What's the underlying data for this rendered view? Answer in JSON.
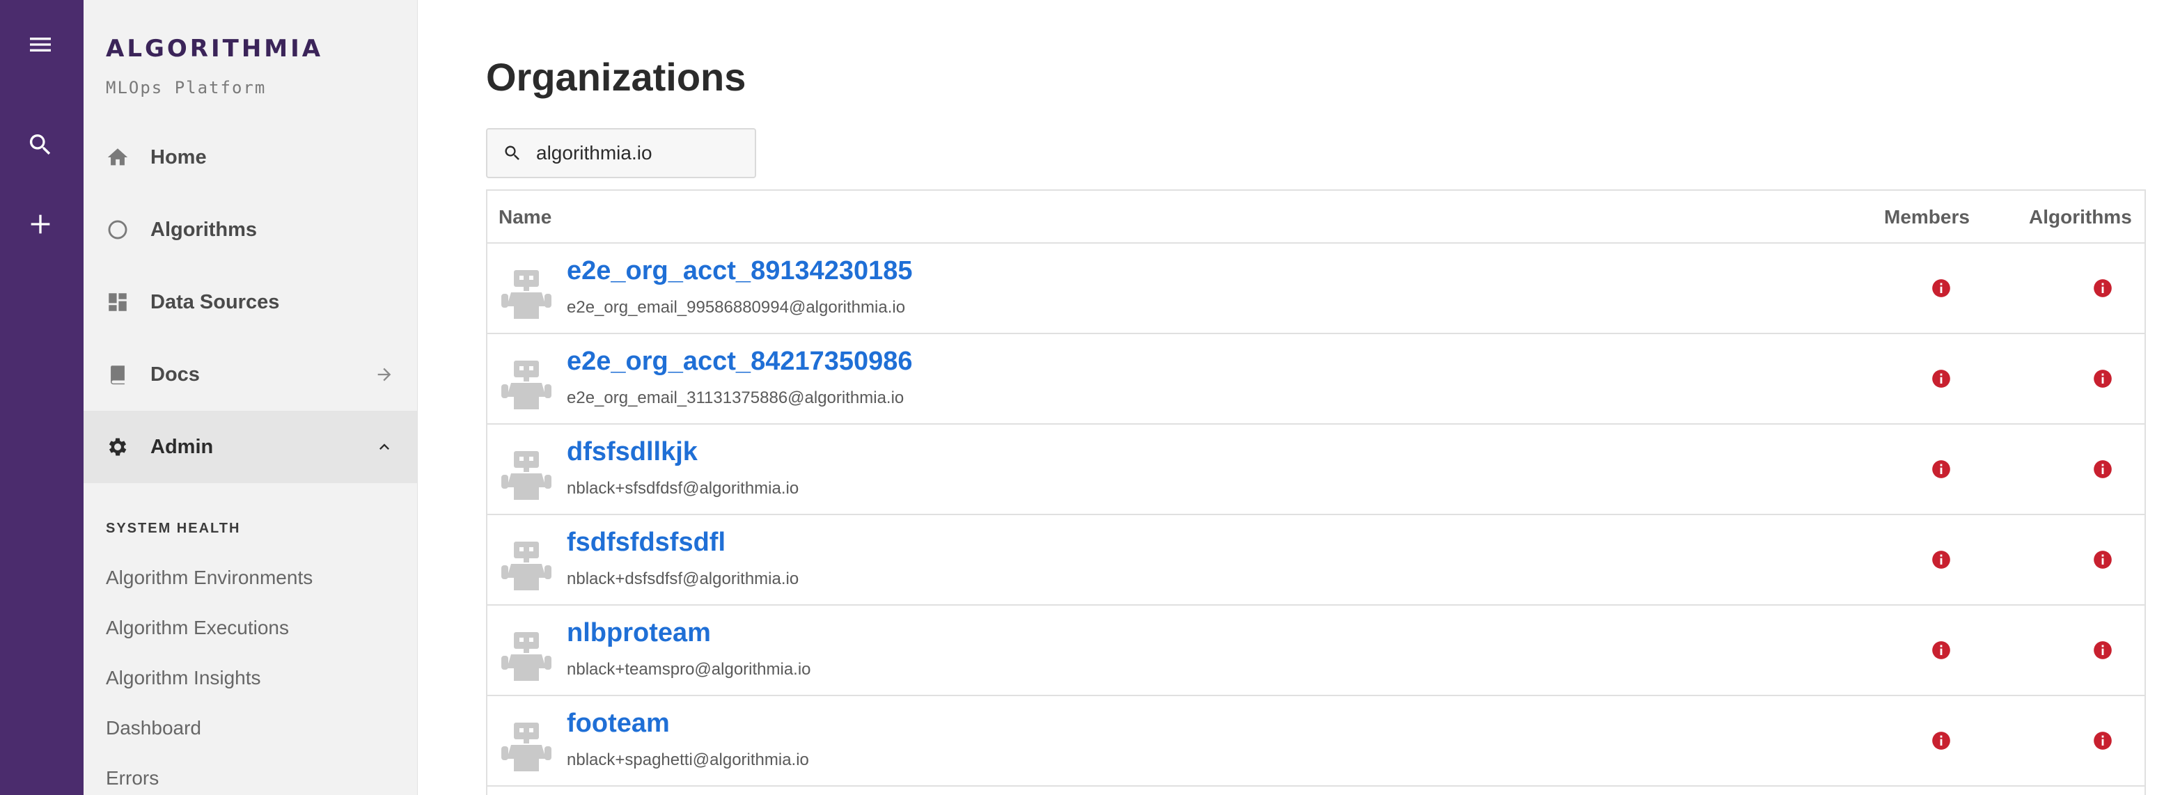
{
  "brand": {
    "name": "ALGORITHMIA",
    "tagline": "MLOps Platform"
  },
  "rail": {
    "icons": [
      "menu-icon",
      "search-icon",
      "plus-icon"
    ]
  },
  "nav": {
    "home": "Home",
    "algorithms": "Algorithms",
    "data_sources": "Data Sources",
    "docs": "Docs",
    "admin": "Admin"
  },
  "system_health": {
    "title": "SYSTEM HEALTH",
    "items": [
      "Algorithm Environments",
      "Algorithm Executions",
      "Algorithm Insights",
      "Dashboard",
      "Errors"
    ]
  },
  "page": {
    "title": "Organizations"
  },
  "search": {
    "value": "algorithmia.io"
  },
  "table": {
    "columns": {
      "name": "Name",
      "members": "Members",
      "algorithms": "Algorithms"
    },
    "rows": [
      {
        "name": "e2e_org_acct_89134230185",
        "email": "e2e_org_email_99586880994@algorithmia.io"
      },
      {
        "name": "e2e_org_acct_84217350986",
        "email": "e2e_org_email_31131375886@algorithmia.io"
      },
      {
        "name": "dfsfsdllkjk",
        "email": "nblack+sfsdfdsf@algorithmia.io"
      },
      {
        "name": "fsdfsfdsfsdfl",
        "email": "nblack+dsfsdfsf@algorithmia.io"
      },
      {
        "name": "nlbproteam",
        "email": "nblack+teamspro@algorithmia.io"
      },
      {
        "name": "footeam",
        "email": "nblack+spaghetti@algorithmia.io"
      }
    ]
  },
  "colors": {
    "rail": "#4b2c6d",
    "link": "#1f6fd6",
    "error": "#c8202f",
    "sidebar": "#f2f2f2"
  }
}
